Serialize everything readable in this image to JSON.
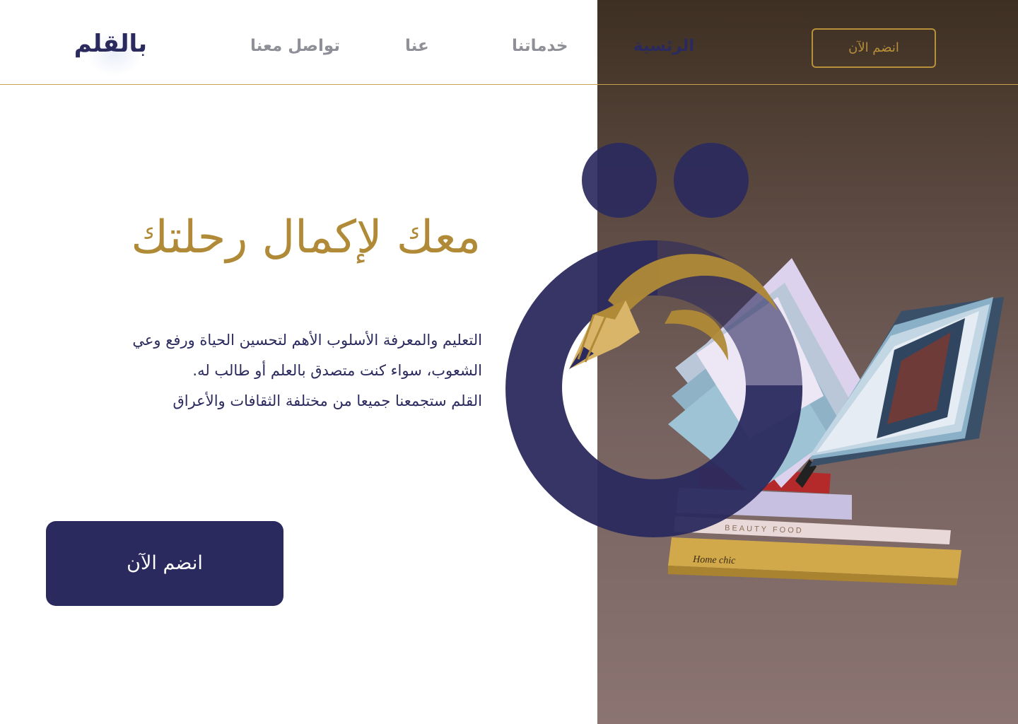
{
  "brand": {
    "logo_text": "بالقلم"
  },
  "nav": {
    "items": [
      {
        "label": "تواصل معنا"
      },
      {
        "label": "عنا"
      },
      {
        "label": "خدماتنا"
      },
      {
        "label": "الرئسية"
      }
    ],
    "active_index": 3,
    "cta_label": "انضم الآن"
  },
  "hero": {
    "title": "معك لإكمال رحلتك",
    "description_lines": [
      "التعليم والمعرفة الأسلوب الأهم لتحسين الحياة ورفع وعي",
      "الشعوب، سواء كنت متصدق بالعلم أو طالب له.",
      "القلم ستجمعنا جميعا من مختلفة الثقافات والأعراق"
    ],
    "cta_label": "انضم الآن"
  },
  "photo": {
    "books": [
      {
        "spine_text": "BEAUTY FOOD"
      },
      {
        "spine_text": "Home chic"
      }
    ]
  },
  "colors": {
    "navy": "#2b2a5e",
    "gold": "#b08a37",
    "muted_nav": "#8f8f97"
  }
}
